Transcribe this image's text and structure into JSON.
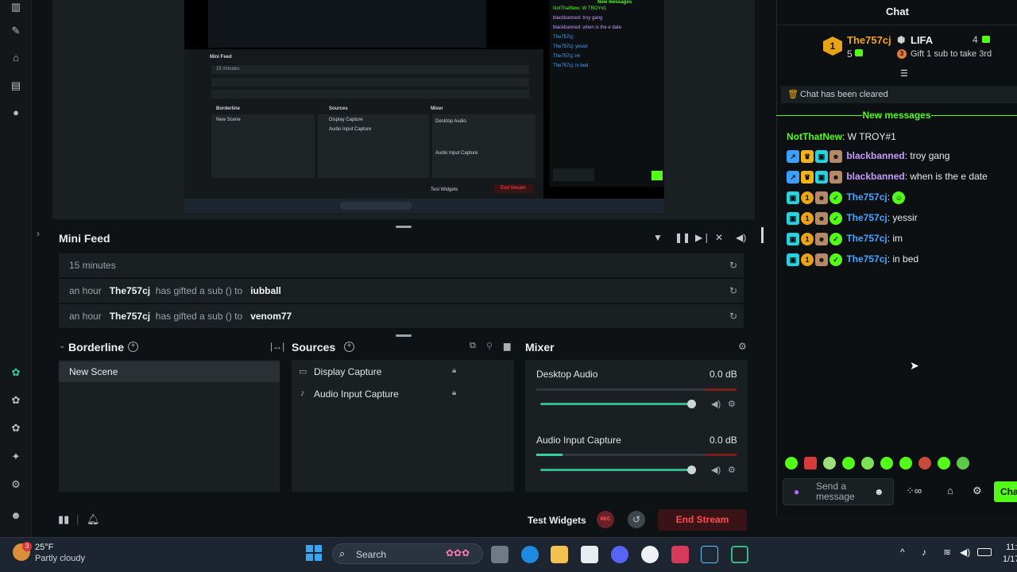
{
  "mini_feed": {
    "title": "Mini Feed",
    "rows": [
      {
        "time": "15 minutes",
        "user": "",
        "mid": "",
        "target": ""
      },
      {
        "time": "an hour",
        "user": "The757cj",
        "mid": "has gifted a sub () to",
        "target": "iubball"
      },
      {
        "time": "an hour",
        "user": "The757cj",
        "mid": "has gifted a sub () to",
        "target": "venom77"
      }
    ]
  },
  "scenes": {
    "title": "Borderline",
    "items": [
      "New Scene"
    ]
  },
  "sources": {
    "title": "Sources",
    "items": [
      "Display Capture",
      "Audio Input Capture"
    ]
  },
  "mixer": {
    "title": "Mixer",
    "channels": [
      {
        "name": "Desktop Audio",
        "db": "0.0 dB",
        "level": 0.0
      },
      {
        "name": "Audio Input Capture",
        "db": "0.0 dB",
        "level": 0.13
      }
    ]
  },
  "bottom": {
    "test_widgets": "Test Widgets",
    "rec": "REC",
    "end_stream": "End Stream"
  },
  "chat": {
    "title": "Chat",
    "leader": {
      "rank1_name": "The757cj",
      "rank1_count": "5",
      "lifa": "LIFA",
      "lifa_count": "4",
      "gift_prompt": "Gift 1 sub to take 3rd"
    },
    "cleared": "Chat has been cleared",
    "new_messages": "New messages",
    "messages": [
      {
        "user": "NotThatNew",
        "text": ": W TROY#1",
        "color": "#53fc18"
      },
      {
        "user": "blackbanned",
        "text": ": troy gang",
        "color": "#c79bff"
      },
      {
        "user": "blackbanned",
        "text": ": when is the e date",
        "color": "#c79bff"
      },
      {
        "user": "The757cj",
        "text": ":",
        "color": "#45a6ff"
      },
      {
        "user": "The757cj",
        "text": ": yessir",
        "color": "#45a6ff"
      },
      {
        "user": "The757cj",
        "text": ": im",
        "color": "#45a6ff"
      },
      {
        "user": "The757cj",
        "text": ": in bed",
        "color": "#45a6ff"
      }
    ],
    "input_placeholder": "Send a message",
    "send_label": "Cha"
  },
  "preview_mini": {
    "chat_lines": [
      "NotThatNew: W TROY#1",
      "blackbanned: troy gang",
      "blackbanned: when is the e date",
      "The757cj:",
      "The757cj: yessir",
      "The757cj: im",
      "The757cj: in bed"
    ],
    "new_messages": "New messages"
  },
  "taskbar": {
    "temp": "25°F",
    "weather": "Partly cloudy",
    "weather_badge": "3",
    "search": "Search",
    "clock_time": "11:",
    "clock_date": "1/17"
  },
  "colors": {
    "kick_green": "#53fc18",
    "end_stream_red": "#ff4b55",
    "panel_bg": "#1a1f22",
    "accent_teal": "#37cfa4"
  }
}
